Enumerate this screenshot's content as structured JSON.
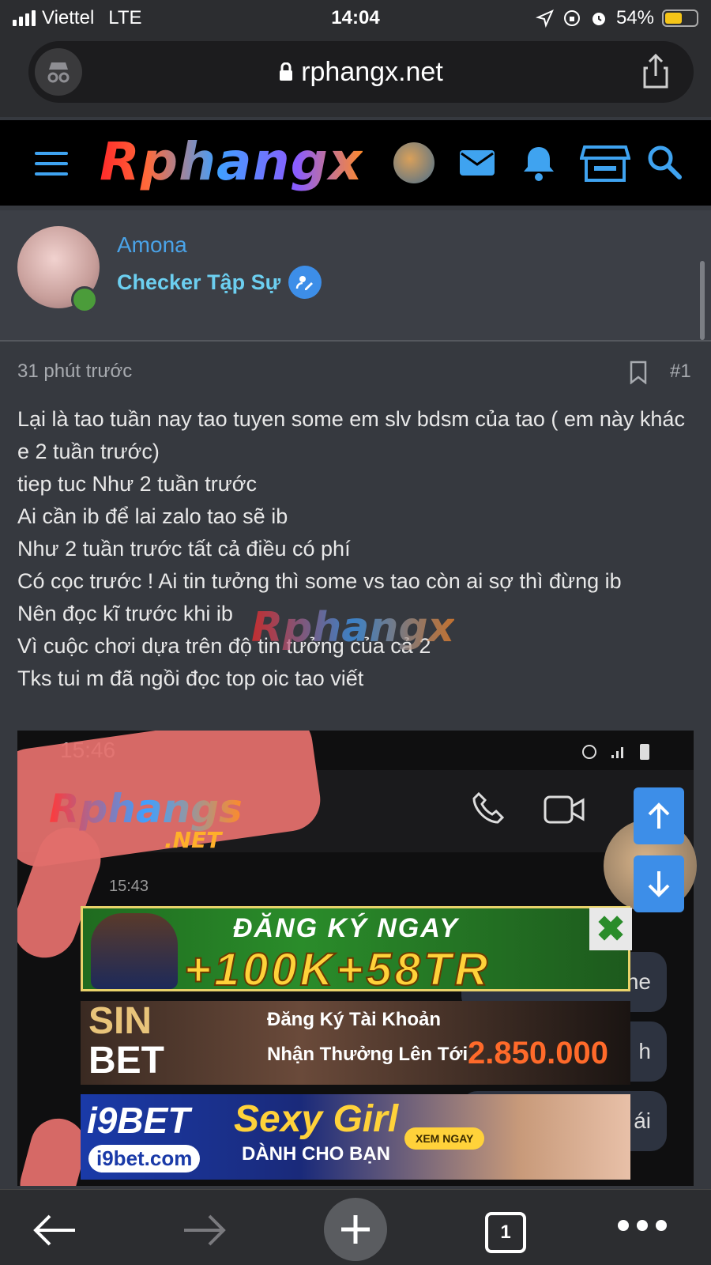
{
  "status_bar": {
    "carrier": "Viettel",
    "network": "LTE",
    "time": "14:04",
    "battery": "54%",
    "battery_level": 0.54
  },
  "browser": {
    "url": "rphangx.net"
  },
  "site": {
    "logo": "Rphangx"
  },
  "post": {
    "author": "Amona",
    "author_title": "Checker Tập Sự",
    "time": "31 phút trước",
    "number": "#1",
    "lines": [
      "Lại là tao tuần nay tao tuyen some em slv bdsm của tao ( em này khác e 2 tuần trước)",
      "tiep tuc Như 2 tuần trước",
      "Ai cần ib để lai zalo tao sẽ ib",
      "Như 2 tuần trước tất cả điều có phí",
      "Có cọc trước ! Ai tin tưởng thì some vs tao còn ai sợ thì đừng ib",
      "Nên đọc kĩ trước khi ib",
      "Vì cuộc chơi dựa trên độ tin tưởng của cả 2",
      "Tks tui m đã ngồi đọc top oic tao viết"
    ],
    "watermark": "Rphangx"
  },
  "attachment": {
    "time": "15:46",
    "logo": "Rphangs",
    "logo_sub": ".NET",
    "msg_time": "15:43",
    "bubbles": [
      "ne",
      "h",
      "ái"
    ]
  },
  "ads": {
    "ad1_line1": "ĐĂNG KÝ NGAY",
    "ad1_line2": "+100K+58TR",
    "ad1_close": "✖",
    "ad2_brand_top": "SIN",
    "ad2_brand_bottom": "BET",
    "ad2_line1": "Đăng Ký Tài Khoản",
    "ad2_line2": "Nhận Thưởng Lên Tới",
    "ad2_amount": "2.850.000",
    "ad3_brand": "i9BET",
    "ad3_site": "i9bet.com",
    "ad3_headline": "Sexy Girl",
    "ad3_sub": "DÀNH CHO BẠN",
    "ad3_button": "XEM NGAY"
  },
  "toolbar": {
    "tab_count": "1"
  },
  "colors": {
    "accent": "#3fa3f0",
    "link": "#4aa3e8",
    "title": "#6ccff0",
    "background": "#36393f"
  }
}
